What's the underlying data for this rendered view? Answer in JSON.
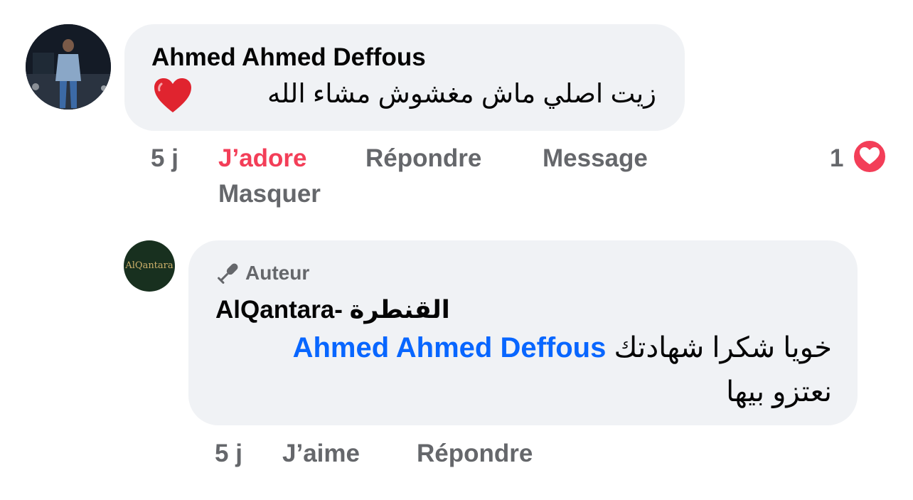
{
  "comment": {
    "author": "Ahmed Ahmed Deffous",
    "text": "زيت اصلي ماش مغشوش مشاء الله",
    "emoji": "red-heart",
    "actions": {
      "time": "5 j",
      "love": "J’adore",
      "reply": "Répondre",
      "message": "Message",
      "hide": "Masquer"
    },
    "reactions": {
      "count": "1",
      "icon": "love-reaction-icon",
      "color": "#f33e58"
    }
  },
  "reply": {
    "avatar_text": "AlQantara",
    "badge_label": "Auteur",
    "badge_icon": "microphone-icon",
    "author": "AlQantara- القنطرة",
    "mention": "Ahmed Ahmed Deffous",
    "text_line1": "خويا شكرا شهادتك",
    "text_line2": "نعتزو بيها",
    "actions": {
      "time": "5 j",
      "like": "J’aime",
      "reply": "Répondre"
    }
  },
  "colors": {
    "bubble": "#f0f2f5",
    "secondary_text": "#65676b",
    "link": "#0866ff",
    "love": "#f33e58"
  }
}
